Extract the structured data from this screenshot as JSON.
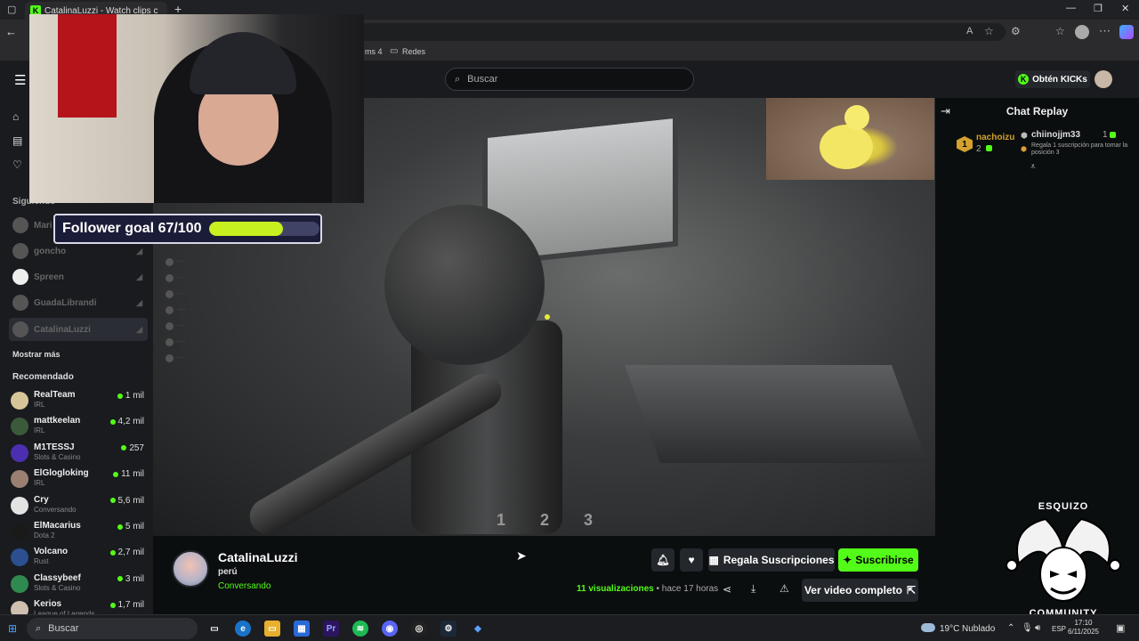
{
  "browser": {
    "tab_title": "CatalinaLuzzi - Watch clips c",
    "bookmarks": [
      "ms 4",
      "Redes"
    ]
  },
  "header": {
    "search_placeholder": "Buscar",
    "get_kicks_label": "Obtén KICKs"
  },
  "sidebar": {
    "following_title": "Siguiendo",
    "following": [
      {
        "name": "Mari"
      },
      {
        "name": "goncho"
      },
      {
        "name": "Spreen"
      },
      {
        "name": "GuadaLibrandi"
      },
      {
        "name": "CatalinaLuzzi"
      }
    ],
    "show_more": "Mostrar más",
    "recommended_title": "Recomendado",
    "recommended": [
      {
        "name": "RealTeam",
        "category": "IRL",
        "viewers": "1 mil",
        "color": "#d7c59a"
      },
      {
        "name": "mattkeelan",
        "category": "IRL",
        "viewers": "4,2 mil",
        "color": "#3a5a3a"
      },
      {
        "name": "M1TESSJ",
        "category": "Slots & Casino",
        "viewers": "257",
        "color": "#4b2fb0"
      },
      {
        "name": "ElGlogloking",
        "category": "IRL",
        "viewers": "11 mil",
        "color": "#9a7f72"
      },
      {
        "name": "Cry",
        "category": "Conversando",
        "viewers": "5,6 mil",
        "color": "#e3e3e3"
      },
      {
        "name": "ElMacarius",
        "category": "Dota 2",
        "viewers": "5 mil",
        "color": "#1a1a1a"
      },
      {
        "name": "Volcano",
        "category": "Rust",
        "viewers": "2,7 mil",
        "color": "#2b4f8f"
      },
      {
        "name": "Classybeef",
        "category": "Slots & Casino",
        "viewers": "3 mil",
        "color": "#2f8a4f"
      },
      {
        "name": "Kerios",
        "category": "League of Legends",
        "viewers": "1,7 mil",
        "color": "#d0c0b0"
      }
    ]
  },
  "overlay": {
    "goal_label": "Follower goal 67/100",
    "goal_fraction": 0.67,
    "hud_numbers": [
      "1",
      "2",
      "3"
    ]
  },
  "chat": {
    "title": "Chat Replay",
    "top_gifter": {
      "name": "nachoizu",
      "rank": "1",
      "count": "2"
    },
    "second_gifter": {
      "name": "chiinojjm33",
      "count": "1",
      "note": "Regala 1 suscripción para tomar la posición 3"
    }
  },
  "channel": {
    "name": "CatalinaLuzzi",
    "title": "perú",
    "category": "Conversando",
    "gift_label": "Regala Suscripciones",
    "subscribe_label": "Suscribirse",
    "views_count": "11",
    "views_label": "visualizaciones",
    "time_ago": "• hace 17 horas",
    "full_video_label": "Ver video completo"
  },
  "logo": {
    "top_text": "ESQUIZO",
    "bottom_text": "COMMUNITY"
  },
  "taskbar": {
    "search_label": "Buscar",
    "weather": "19°C",
    "weather_desc": "Nublado",
    "lang": "ESP",
    "time": "17:10",
    "date": "6/11/2025"
  },
  "colors": {
    "kick_green": "#53fc18",
    "panel_dark": "#191b1f",
    "goal_fill": "#c6f01f"
  }
}
